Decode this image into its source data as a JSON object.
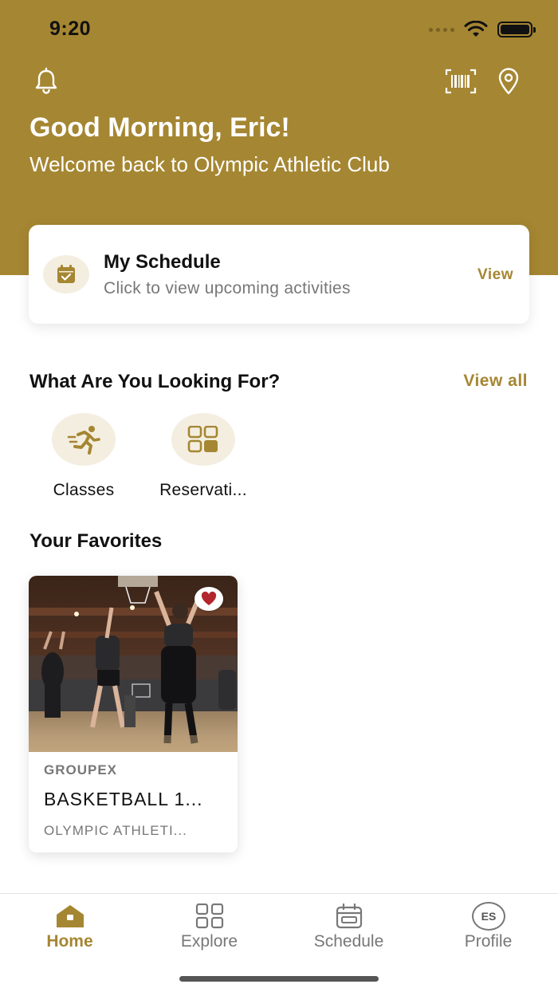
{
  "status_bar": {
    "time": "9:20"
  },
  "header": {
    "greeting": "Good Morning, Eric!",
    "welcome": "Welcome back to Olympic Athletic Club",
    "icons": [
      "bell-icon",
      "barcode-icon",
      "location-pin-icon"
    ]
  },
  "schedule_card": {
    "title": "My Schedule",
    "subtitle": "Click to view upcoming activities",
    "action": "View",
    "icon": "calendar-check-icon"
  },
  "looking_for": {
    "title": "What Are You Looking For?",
    "view_all": "View all",
    "categories": [
      {
        "label": "Classes",
        "icon": "running-person-icon"
      },
      {
        "label": "Reservati...",
        "icon": "grid-icon"
      }
    ]
  },
  "favorites": {
    "title": "Your Favorites",
    "items": [
      {
        "type": "GROUPEX",
        "name": "BASKETBALL 1...",
        "location": "OLYMPIC ATHLETI...",
        "favorited": true
      }
    ]
  },
  "tabbar": {
    "items": [
      {
        "label": "Home",
        "icon": "home-icon",
        "active": true
      },
      {
        "label": "Explore",
        "icon": "grid-icon",
        "active": false
      },
      {
        "label": "Schedule",
        "icon": "calendar-icon",
        "active": false
      },
      {
        "label": "Profile",
        "icon": "avatar-icon",
        "initials": "ES",
        "active": false
      }
    ]
  },
  "colors": {
    "brand": "#a58632",
    "brand_light": "#f4eee0",
    "text_muted": "#777777"
  }
}
